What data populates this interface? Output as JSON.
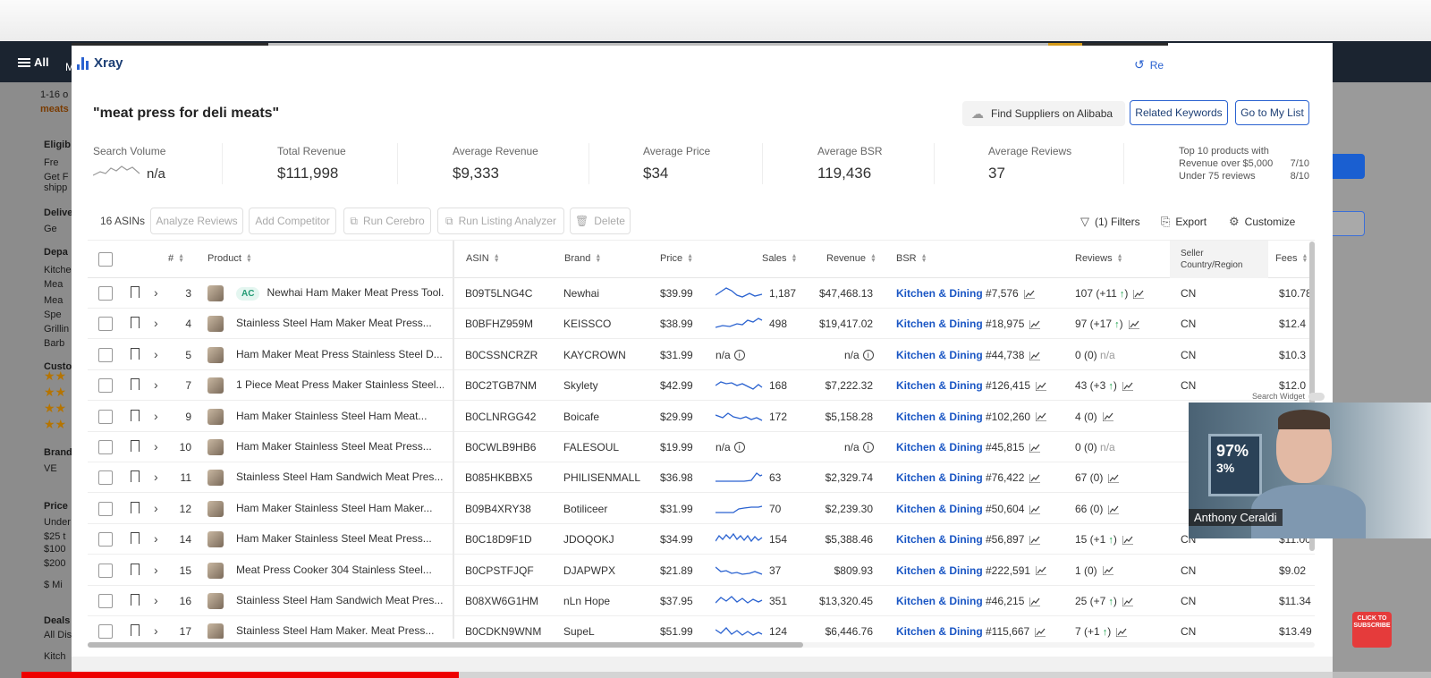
{
  "amazon": {
    "all_label": "All",
    "menu_letter": "M",
    "results_text": "1-16 o",
    "query_snippet": "meats",
    "sidebar": [
      "Eligib",
      "Fre",
      "Get F",
      "shipp",
      "Delive",
      "Ge",
      "Depa",
      "Kitche",
      "Mea",
      "Mea",
      "Spe",
      "Grillin",
      "Barb",
      "Custo",
      "Brand",
      "VE",
      "Price",
      "Under",
      "$25 t",
      "$100",
      "$200",
      "$ Mi",
      "Deals",
      "All Dis",
      "Kitch"
    ]
  },
  "xray": {
    "title": "Xray",
    "reset_label": "Re",
    "query": "\"meat press for deli meats\"",
    "alibaba_label": "Find Suppliers on Alibaba",
    "related_keywords_label": "Related Keywords",
    "go_to_list_label": "Go to My List",
    "metrics": {
      "search_volume": {
        "label": "Search Volume",
        "value": "n/a"
      },
      "total_revenue": {
        "label": "Total Revenue",
        "value": "$111,998"
      },
      "average_revenue": {
        "label": "Average Revenue",
        "value": "$9,333"
      },
      "average_price": {
        "label": "Average Price",
        "value": "$34"
      },
      "average_bsr": {
        "label": "Average BSR",
        "value": "119,436"
      },
      "average_reviews": {
        "label": "Average Reviews",
        "value": "37"
      }
    },
    "top10": {
      "title": "Top 10 products with",
      "rev_label": "Revenue over $5,000",
      "rev_value": "7/10",
      "reviews_label": "Under 75 reviews",
      "reviews_value": "8/10"
    },
    "toolbar": {
      "count": "16 ASINs",
      "analyze_reviews": "Analyze Reviews",
      "add_competitor": "Add Competitor",
      "run_cerebro": "Run Cerebro",
      "run_listing_analyzer": "Run Listing Analyzer",
      "delete": "Delete",
      "filters": "(1) Filters",
      "export": "Export",
      "customize": "Customize"
    },
    "columns": {
      "num": "#",
      "product": "Product",
      "asin": "ASIN",
      "brand": "Brand",
      "price": "Price",
      "sales": "Sales",
      "revenue": "Revenue",
      "bsr": "BSR",
      "reviews": "Reviews",
      "seller_line1": "Seller",
      "seller_line2": "Country/Region",
      "fees": "Fees"
    },
    "rows": [
      {
        "num": "3",
        "ac": "AC",
        "product": "Newhai Ham Maker Meat Press Tool...",
        "asin": "B09T5LNG4C",
        "brand": "Newhai",
        "price": "$39.99",
        "sales": "1,187",
        "revenue": "$47,468.13",
        "bsr_cat": "Kitchen & Dining",
        "bsr": "#7,576",
        "reviews": "107",
        "rev_change": "(+11",
        "country": "CN",
        "fees": "$10.78"
      },
      {
        "num": "4",
        "ac": "",
        "product": "Stainless Steel Ham Maker Meat Press...",
        "asin": "B0BFHZ959M",
        "brand": "KEISSCO",
        "price": "$38.99",
        "sales": "498",
        "revenue": "$19,417.02",
        "bsr_cat": "Kitchen & Dining",
        "bsr": "#18,975",
        "reviews": "97",
        "rev_change": "(+17",
        "country": "CN",
        "fees": "$12.4"
      },
      {
        "num": "5",
        "ac": "",
        "product": "Ham Maker Meat Press Stainless Steel D...",
        "asin": "B0CSSNCRZR",
        "brand": "KAYCROWN",
        "price": "$31.99",
        "sales": "n/a",
        "revenue": "n/a",
        "bsr_cat": "Kitchen & Dining",
        "bsr": "#44,738",
        "reviews": "0",
        "rev_change": "(0)",
        "rev_na": "n/a",
        "country": "CN",
        "fees": "$10.3"
      },
      {
        "num": "7",
        "ac": "",
        "product": "1 Piece Meat Press Maker Stainless Steel...",
        "asin": "B0C2TGB7NM",
        "brand": "Skylety",
        "price": "$42.99",
        "sales": "168",
        "revenue": "$7,222.32",
        "bsr_cat": "Kitchen & Dining",
        "bsr": "#126,415",
        "reviews": "43",
        "rev_change": "(+3",
        "country": "CN",
        "fees": "$12.0"
      },
      {
        "num": "9",
        "ac": "",
        "product": "Ham Maker Stainless Steel Ham Meat...",
        "asin": "B0CLNRGG42",
        "brand": "Boicafe",
        "price": "$29.99",
        "sales": "172",
        "revenue": "$5,158.28",
        "bsr_cat": "Kitchen & Dining",
        "bsr": "#102,260",
        "reviews": "4",
        "rev_change": "(0)",
        "country": "",
        "fees": ""
      },
      {
        "num": "10",
        "ac": "",
        "product": "Ham Maker Stainless Steel Meat Press...",
        "asin": "B0CWLB9HB6",
        "brand": "FALESOUL",
        "price": "$19.99",
        "sales": "n/a",
        "revenue": "n/a",
        "bsr_cat": "Kitchen & Dining",
        "bsr": "#45,815",
        "reviews": "0",
        "rev_change": "(0)",
        "rev_na": "n/a",
        "country": "",
        "fees": ""
      },
      {
        "num": "11",
        "ac": "",
        "product": "Stainless Steel Ham Sandwich Meat Pres...",
        "asin": "B085HKBBX5",
        "brand": "PHILISENMALL",
        "price": "$36.98",
        "sales": "63",
        "revenue": "$2,329.74",
        "bsr_cat": "Kitchen & Dining",
        "bsr": "#76,422",
        "reviews": "67",
        "rev_change": "(0)",
        "country": "",
        "fees": ""
      },
      {
        "num": "12",
        "ac": "",
        "product": "Ham Maker Stainless Steel Ham Maker...",
        "asin": "B09B4XRY38",
        "brand": "Botiliceer",
        "price": "$31.99",
        "sales": "70",
        "revenue": "$2,239.30",
        "bsr_cat": "Kitchen & Dining",
        "bsr": "#50,604",
        "reviews": "66",
        "rev_change": "(0)",
        "country": "",
        "fees": ""
      },
      {
        "num": "14",
        "ac": "",
        "product": "Ham Maker Stainless Steel Meat Press...",
        "asin": "B0C18D9F1D",
        "brand": "JDOQOKJ",
        "price": "$34.99",
        "sales": "154",
        "revenue": "$5,388.46",
        "bsr_cat": "Kitchen & Dining",
        "bsr": "#56,897",
        "reviews": "15",
        "rev_change": "(+1",
        "country": "CN",
        "fees": "$11.00"
      },
      {
        "num": "15",
        "ac": "",
        "product": "Meat Press Cooker 304 Stainless Steel...",
        "asin": "B0CPSTFJQF",
        "brand": "DJAPWPX",
        "price": "$21.89",
        "sales": "37",
        "revenue": "$809.93",
        "bsr_cat": "Kitchen & Dining",
        "bsr": "#222,591",
        "reviews": "1",
        "rev_change": "(0)",
        "country": "CN",
        "fees": "$9.02"
      },
      {
        "num": "16",
        "ac": "",
        "product": "Stainless Steel Ham Sandwich Meat Pres...",
        "asin": "B08XW6G1HM",
        "brand": "nLn Hope",
        "price": "$37.95",
        "sales": "351",
        "revenue": "$13,320.45",
        "bsr_cat": "Kitchen & Dining",
        "bsr": "#46,215",
        "reviews": "25",
        "rev_change": "(+7",
        "country": "CN",
        "fees": "$11.34"
      },
      {
        "num": "17",
        "ac": "",
        "product": "Stainless Steel Ham Maker. Meat Press...",
        "asin": "B0CDKN9WNM",
        "brand": "SupeL",
        "price": "$51.99",
        "sales": "124",
        "revenue": "$6,446.76",
        "bsr_cat": "Kitchen & Dining",
        "bsr": "#115,667",
        "reviews": "7",
        "rev_change": "(+1",
        "country": "CN",
        "fees": "$13.49"
      }
    ]
  },
  "overlay": {
    "presenter_name": "Anthony Ceraldi",
    "poster_text": "97%",
    "poster_text2": "3%",
    "search_widget_label": "Search Widget",
    "subscribe_label": "CLICK TO SUBSCRIBE"
  },
  "video_progress": 0.31,
  "colors": {
    "accent": "#2a62d0",
    "link": "#1a56c4",
    "positive": "#1aa04a"
  }
}
